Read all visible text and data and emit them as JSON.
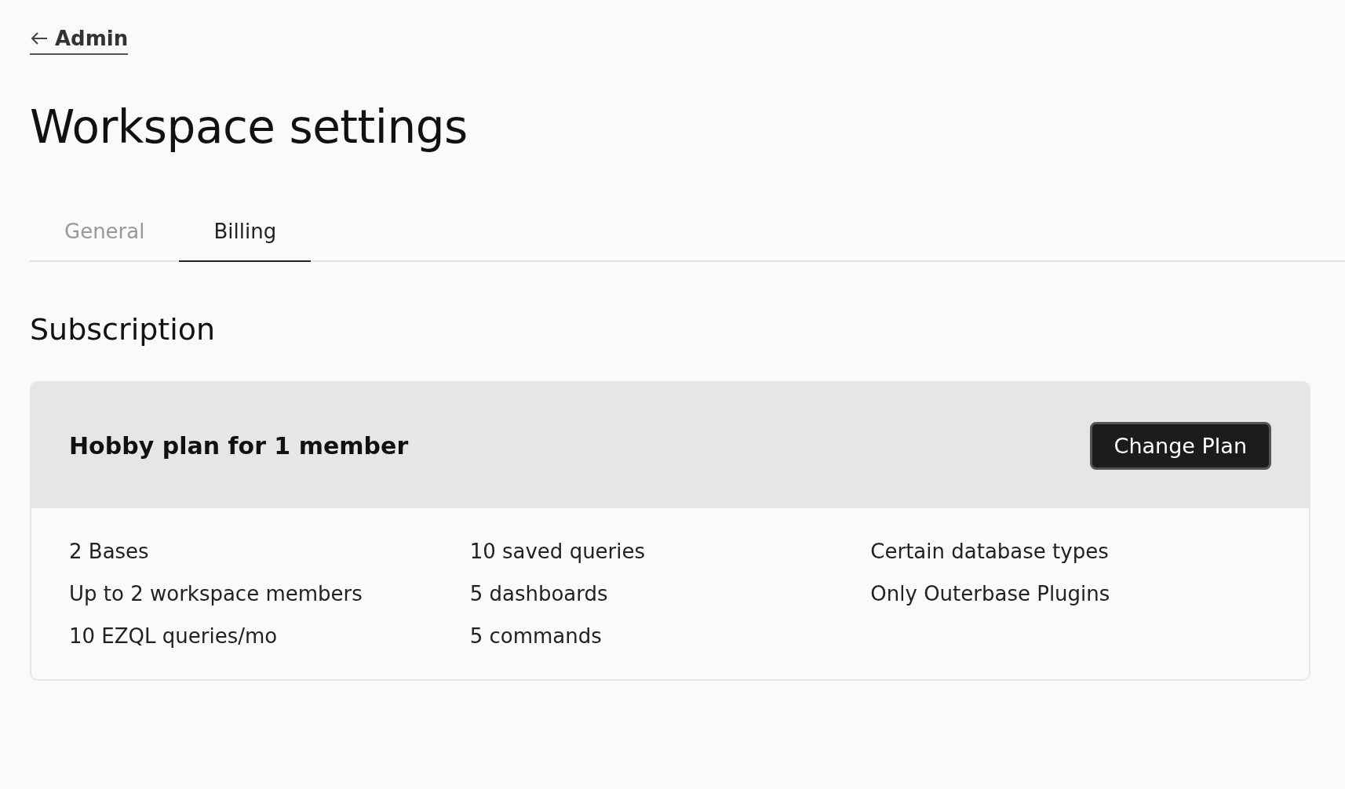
{
  "back_link": {
    "label": "Admin"
  },
  "title": "Workspace settings",
  "tabs": [
    {
      "label": "General",
      "selected": false
    },
    {
      "label": "Billing",
      "selected": true
    }
  ],
  "section_title": "Subscription",
  "plan": {
    "title": "Hobby plan for 1 member",
    "button": "Change Plan",
    "features": [
      [
        "2 Bases",
        "Up to 2 workspace members",
        "10 EZQL queries/mo"
      ],
      [
        "10 saved queries",
        "5 dashboards",
        "5 commands"
      ],
      [
        "Certain database types",
        "Only Outerbase Plugins"
      ]
    ]
  }
}
